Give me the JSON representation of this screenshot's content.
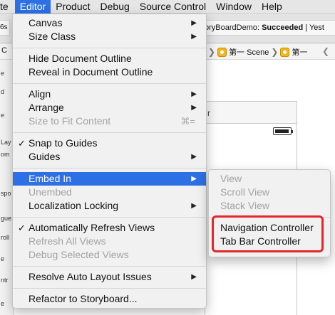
{
  "menubar": {
    "items": [
      "te",
      "Editor",
      "Product",
      "Debug",
      "Source Control",
      "Window",
      "Help"
    ]
  },
  "background": {
    "left_tab": "6s",
    "status_prefix": "oryBoardDemo: ",
    "status_value": "Succeeded",
    "status_suffix": " | Yest",
    "jumpbar_left": "C",
    "crumb_scene": "第一 Scene",
    "crumb_second": "第一",
    "vc_title": "r",
    "outline_items": [
      "e",
      "d",
      "e",
      "Lay",
      "om",
      "spo",
      "gue",
      "roll",
      "e",
      "ntr",
      "e"
    ]
  },
  "editor_menu": {
    "canvas": "Canvas",
    "size_class": "Size Class",
    "hide_outline": "Hide Document Outline",
    "reveal_outline": "Reveal in Document Outline",
    "align": "Align",
    "arrange": "Arrange",
    "size_to_fit": "Size to Fit Content",
    "size_to_fit_shortcut": "⌘=",
    "snap_to_guides": "Snap to Guides",
    "guides": "Guides",
    "embed_in": "Embed In",
    "unembed": "Unembed",
    "localization_locking": "Localization Locking",
    "auto_refresh": "Automatically Refresh Views",
    "refresh_all": "Refresh All Views",
    "debug_selected": "Debug Selected Views",
    "resolve_auto_layout": "Resolve Auto Layout Issues",
    "refactor_storyboard": "Refactor to Storyboard..."
  },
  "embed_submenu": {
    "view": "View",
    "scroll_view": "Scroll View",
    "stack_view": "Stack View",
    "navigation_controller": "Navigation Controller",
    "tab_bar_controller": "Tab Bar Controller"
  },
  "colors": {
    "highlight": "#2d6fe5",
    "annotation_red": "#e3262a"
  }
}
